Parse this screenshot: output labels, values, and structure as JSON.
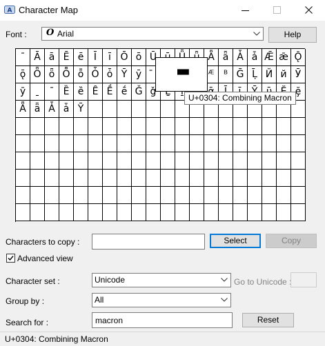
{
  "window": {
    "title": "Character Map",
    "minimize_icon": "minimize-icon",
    "maximize_icon": "maximize-icon",
    "close_icon": "close-icon"
  },
  "font": {
    "label": "Font :",
    "value": "Arial",
    "help_label": "Help"
  },
  "grid": {
    "chars": [
      "¯",
      "Ā",
      "ā",
      "Ē",
      "ē",
      "Ī",
      "ī",
      "Ō",
      "ō",
      "Ū",
      "ū",
      "Ǖ",
      "ǖ",
      "Ǟ",
      "ǟ",
      "Ǡ",
      "ǡ",
      "Ǣ",
      "ǣ",
      "Ǭ",
      "ǭ",
      "Ȫ",
      "ȫ",
      "Ȭ",
      "ȭ",
      "Ȱ",
      "ȱ",
      "Ȳ",
      "ȳ",
      "̄",
      "̱",
      "ͅ",
      "ᴬ",
      "ᴭ",
      "ᴮ",
      "Ḡ",
      "Ḹ",
      "Й",
      "й",
      "Ӯ",
      "ӯ",
      "ˍ",
      "ˉ",
      "Ȅ",
      "ȅ",
      "Ȇ",
      "Ḗ",
      "ḗ",
      "Ǧ",
      "ǧ",
      "Ḻ",
      "ḻ",
      "ᾰ",
      "ᾱ",
      "Ῑ",
      "ῑ",
      "Ῡ",
      "ῡ",
      "Ḝ",
      "ḝ",
      "Ǟ",
      "ǟ",
      "Ǡ",
      "ǡ",
      "Ȳ",
      "",
      "",
      "",
      "",
      "",
      "",
      "",
      "",
      "",
      "",
      "",
      "",
      "",
      "",
      ""
    ]
  },
  "magnifier": {
    "char": "▬"
  },
  "tooltip": {
    "text": "U+0304: Combining Macron"
  },
  "copy": {
    "label": "Characters to copy :",
    "value": "",
    "select_label": "Select",
    "copy_label": "Copy"
  },
  "advanced": {
    "label": "Advanced view",
    "checked": true
  },
  "charset": {
    "label": "Character set :",
    "value": "Unicode",
    "goto_label": "Go to Unicode :",
    "goto_value": ""
  },
  "groupby": {
    "label": "Group by :",
    "value": "All"
  },
  "search": {
    "label": "Search for :",
    "value": "macron",
    "reset_label": "Reset"
  },
  "status": {
    "text": "U+0304: Combining Macron"
  }
}
